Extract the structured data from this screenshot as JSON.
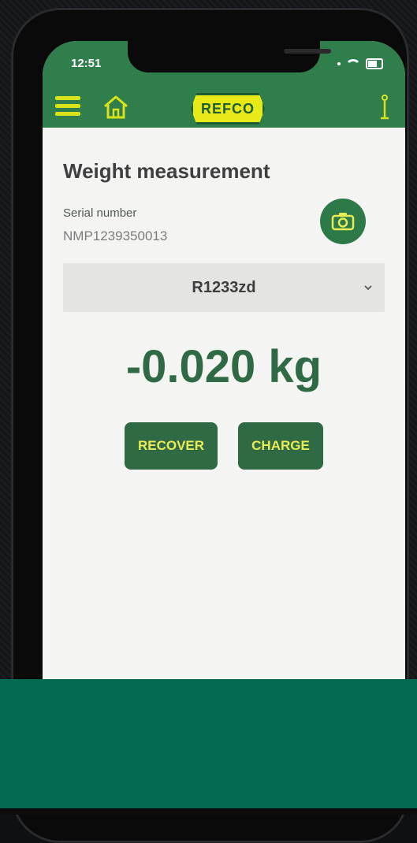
{
  "status": {
    "time": "12:51"
  },
  "header": {
    "logo_text": "REFCO"
  },
  "page": {
    "title": "Weight measurement",
    "serial_label": "Serial number",
    "serial_value": "NMP1239350013",
    "refrigerant": "R1233zd",
    "weight": "-0.020 kg",
    "recover_label": "RECOVER",
    "charge_label": "CHARGE"
  },
  "colors": {
    "brand_green": "#2f7e4c",
    "button_green": "#2f6a45",
    "accent_yellow": "#e8ec55",
    "band_green": "#046a50"
  }
}
